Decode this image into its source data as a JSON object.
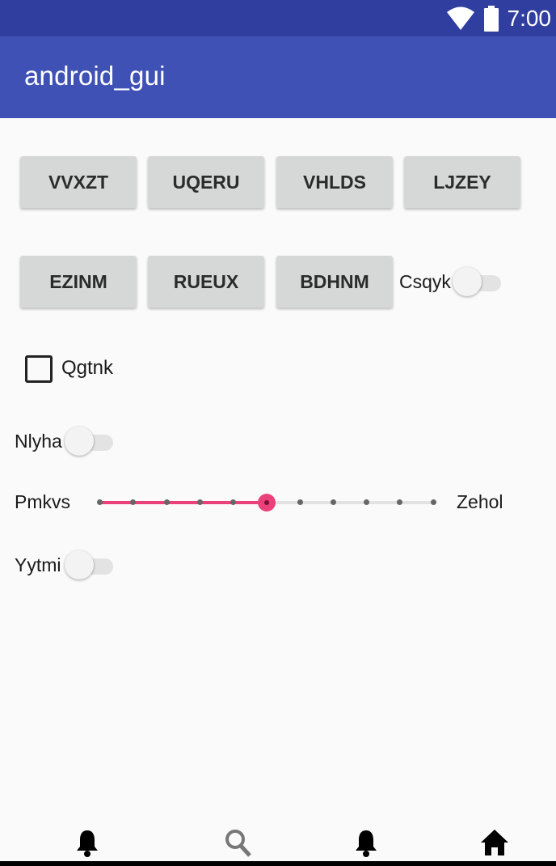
{
  "status_bar": {
    "time": "7:00",
    "icons": [
      "wifi-icon",
      "battery-icon"
    ],
    "background": "#303f9f"
  },
  "app_bar": {
    "title": "android_gui",
    "background": "#3f51b5"
  },
  "buttons": {
    "row1": [
      "VVXZT",
      "UQERU",
      "VHLDS",
      "LJZEY"
    ],
    "row2": [
      "EZINM",
      "RUEUX",
      "BDHNM"
    ]
  },
  "switches": {
    "csqyk": {
      "label": "Csqyk",
      "on": false
    },
    "nlyha": {
      "label": "Nlyha",
      "on": false
    },
    "yytmi": {
      "label": "Yytmi",
      "on": false
    }
  },
  "checkbox": {
    "label": "Qgtnk",
    "checked": false
  },
  "seekbar": {
    "left_label": "Pmkvs",
    "right_label": "Zehol",
    "value": 5,
    "max": 10,
    "accent": "#ec407a"
  },
  "bottom_nav": {
    "icons": [
      "bell-icon",
      "search-icon",
      "bell-icon",
      "home-icon"
    ]
  }
}
